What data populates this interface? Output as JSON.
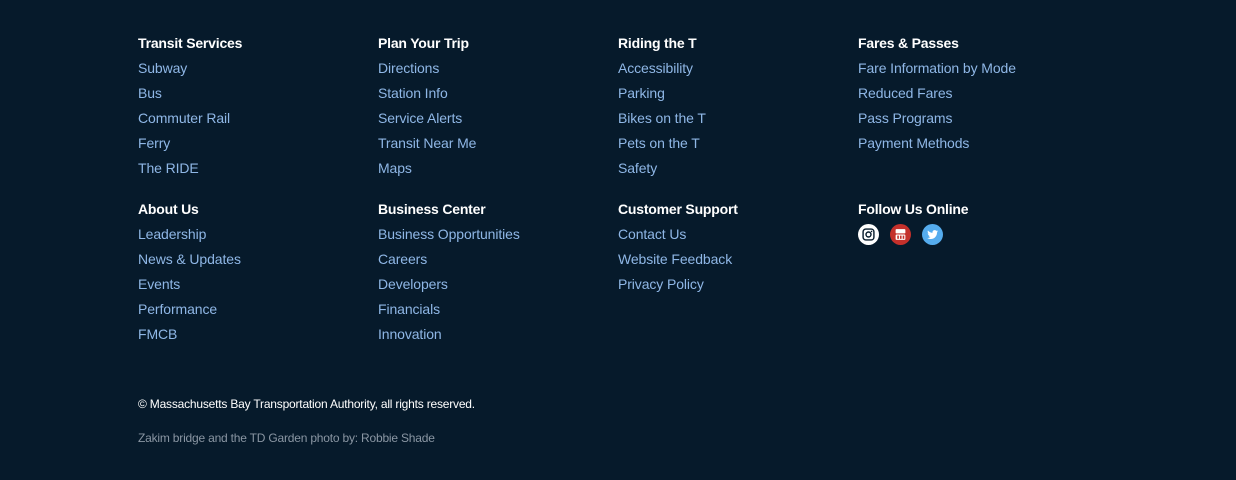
{
  "columns_row1": [
    {
      "title": "Transit Services",
      "links": [
        "Subway",
        "Bus",
        "Commuter Rail",
        "Ferry",
        "The RIDE"
      ]
    },
    {
      "title": "Plan Your Trip",
      "links": [
        "Directions",
        "Station Info",
        "Service Alerts",
        "Transit Near Me",
        "Maps"
      ]
    },
    {
      "title": "Riding the T",
      "links": [
        "Accessibility",
        "Parking",
        "Bikes on the T",
        "Pets on the T",
        "Safety"
      ]
    },
    {
      "title": "Fares & Passes",
      "links": [
        "Fare Information by Mode",
        "Reduced Fares",
        "Pass Programs",
        "Payment Methods"
      ]
    }
  ],
  "columns_row2": [
    {
      "title": "About Us",
      "links": [
        "Leadership",
        "News & Updates",
        "Events",
        "Performance",
        "FMCB"
      ]
    },
    {
      "title": "Business Center",
      "links": [
        "Business Opportunities",
        "Careers",
        "Developers",
        "Financials",
        "Innovation"
      ]
    },
    {
      "title": "Customer Support",
      "links": [
        "Contact Us",
        "Website Feedback",
        "Privacy Policy"
      ]
    }
  ],
  "follow": {
    "title": "Follow Us Online",
    "icons": [
      "instagram-icon",
      "youtube-icon",
      "twitter-icon"
    ]
  },
  "colors": {
    "background": "#061a2b",
    "link": "#8fb7e6",
    "heading": "#ffffff",
    "credit": "#8a96a3"
  },
  "copyright": "© Massachusetts Bay Transportation Authority, all rights reserved.",
  "photo_credit": "Zakim bridge and the TD Garden photo by: Robbie Shade"
}
